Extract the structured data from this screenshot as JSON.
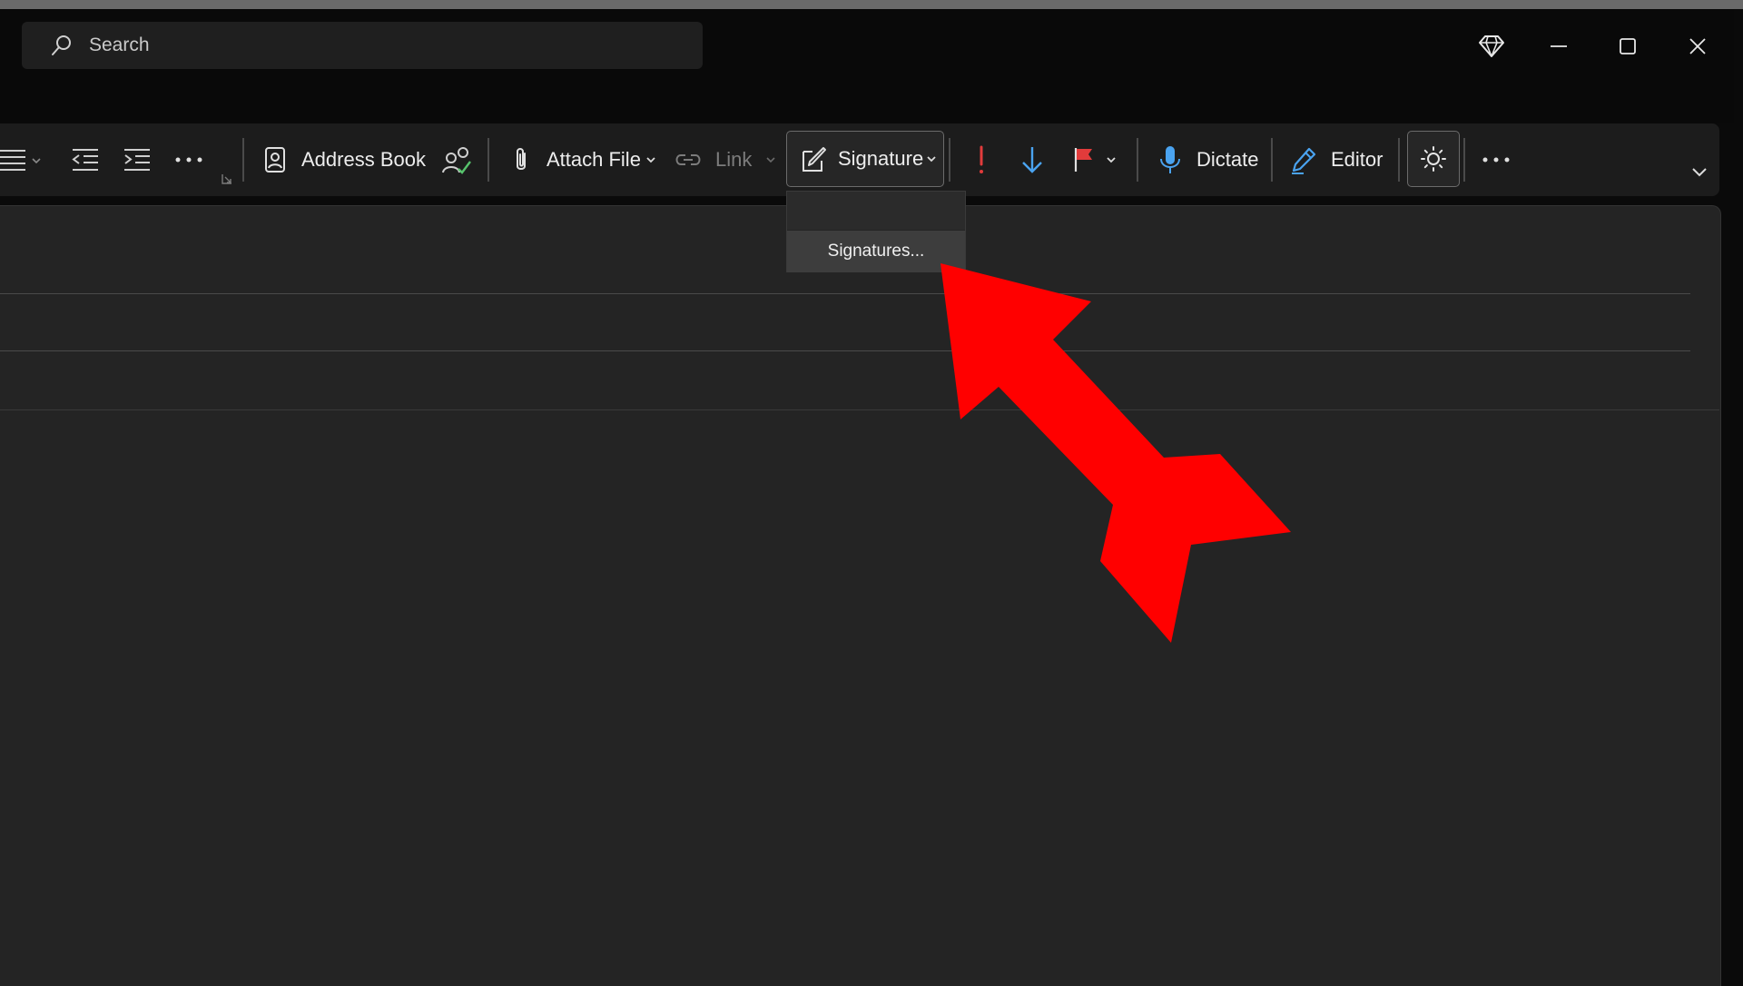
{
  "search": {
    "placeholder": "Search"
  },
  "ribbon": {
    "address_book": "Address Book",
    "attach_file": "Attach File",
    "link": "Link",
    "signature": "Signature",
    "dictate": "Dictate",
    "editor": "Editor"
  },
  "dropdown": {
    "items": [
      {
        "label": "Signatures..."
      }
    ]
  },
  "icons": {
    "search": "search-icon",
    "premium": "diamond-icon",
    "minimize": "minimize-icon",
    "maximize": "maximize-icon",
    "close": "close-icon",
    "align": "align-icon",
    "decrease_indent": "decrease-indent-icon",
    "increase_indent": "increase-indent-icon",
    "more": "more-icon",
    "address_book": "address-book-icon",
    "check_names": "check-names-icon",
    "attach": "paperclip-icon",
    "link": "link-icon",
    "signature": "signature-icon",
    "high_importance": "exclamation-icon",
    "low_importance": "down-arrow-icon",
    "flag": "flag-icon",
    "microphone": "microphone-icon",
    "editor": "editor-pen-icon",
    "sun": "sun-icon",
    "collapse": "chevron-down-icon"
  },
  "colors": {
    "background": "#0a0a0a",
    "ribbon": "#1c1c1c",
    "compose": "#242424",
    "accent_blue": "#4aa3f0",
    "importance_red": "#e23b3b",
    "annotation_arrow": "#ff0000"
  }
}
